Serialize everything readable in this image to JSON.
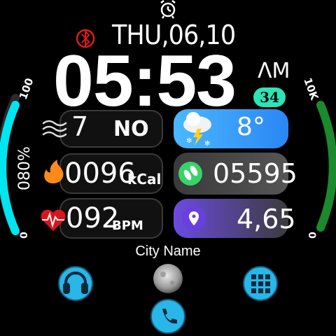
{
  "status": {
    "alarm_icon": "alarm-clock-icon",
    "bluetooth_icon": "bluetooth-icon"
  },
  "date": "THU,06,10",
  "time": "05:53",
  "ampm": "ΛM",
  "day_of_year": "34",
  "left_gauge": {
    "top_label": "100",
    "mid_label": "080%",
    "bottom_label": "0",
    "value_percent": 80,
    "color": "#00e5f0"
  },
  "right_gauge": {
    "top_label": "10K",
    "bottom_label": "0",
    "value_fraction": 0.56,
    "color": "#1fbf3a"
  },
  "wind": {
    "value": "7",
    "direction": "NO",
    "icon": "wind-icon"
  },
  "calories": {
    "value": "0096",
    "unit": "kCal",
    "icon": "flame-icon"
  },
  "heart_rate": {
    "value": "092",
    "unit": "BPM",
    "icon": "heart-rate-icon"
  },
  "weather": {
    "temperature": "8°",
    "icon": "thunder-snow-cloud-icon",
    "color": "#3aa8ff"
  },
  "steps": {
    "value": "05595",
    "icon": "footprint-icon",
    "color": "#9cf0a8"
  },
  "distance": {
    "value": "4,65",
    "icon": "location-pin-icon",
    "color": "#8a6cf0"
  },
  "city": "City Name",
  "buttons": {
    "music_icon": "headphones-icon",
    "moon_icon": "moon-phase-icon",
    "apps_icon": "app-grid-icon",
    "phone_icon": "phone-icon",
    "button_color": "#29b6e8"
  }
}
